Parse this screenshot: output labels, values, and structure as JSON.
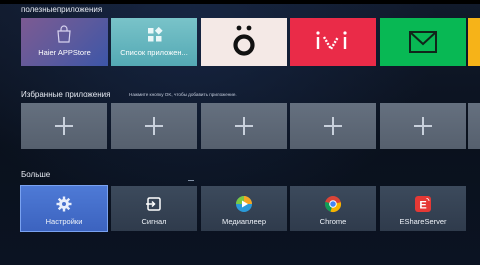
{
  "row1": {
    "title": "полезныеприложения",
    "tiles": [
      {
        "name": "Haier APPStore"
      },
      {
        "name": "Список приложен..."
      },
      {
        "name": "okko"
      },
      {
        "name": "ivi"
      },
      {
        "name": "envelope-app"
      },
      {
        "name": "yellow-app"
      }
    ]
  },
  "row2": {
    "title": "Избранные приложения",
    "hint": "Нажмите кнопку OK, чтобы добавить приложение."
  },
  "row3": {
    "title": "Больше",
    "tiles": [
      {
        "label": "Настройки",
        "icon": "gear-icon"
      },
      {
        "label": "Сигнал",
        "icon": "input-source-icon"
      },
      {
        "label": "Медиаплеер",
        "icon": "mediaplayer-icon"
      },
      {
        "label": "Chrome",
        "icon": "chrome-icon"
      },
      {
        "label": "EShareServer",
        "icon": "eshare-icon"
      }
    ]
  },
  "colors": {
    "haier": "#5e5a9c",
    "list": "#60b0bb",
    "okko": "#f4e9e6",
    "ivi": "#ea2b48",
    "mail": "#08b854",
    "yellow": "#f6b318",
    "selected": "#4a72cf"
  }
}
